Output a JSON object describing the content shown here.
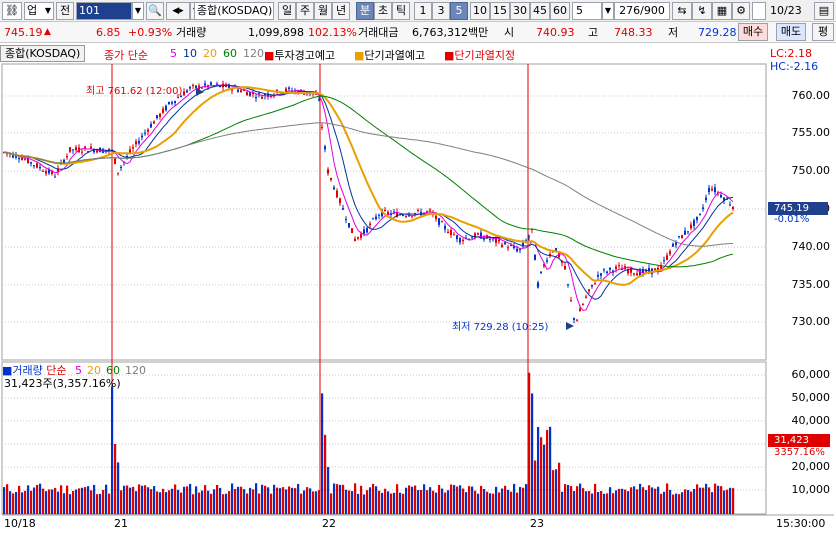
{
  "toolbar": {
    "market": "업",
    "code_label": "전",
    "code_value": "101",
    "index_name": "종합(KOSDAQ)",
    "periods": [
      "일",
      "주",
      "월",
      "년",
      "분",
      "초",
      "틱"
    ],
    "active_period": "분",
    "minutes": [
      "1",
      "3",
      "5",
      "10",
      "15",
      "30",
      "45",
      "60"
    ],
    "active_minute": "5",
    "interval_value": "5",
    "count_display": "276/900",
    "date": "10/23"
  },
  "quote": {
    "price": "745.19",
    "change": "6.85",
    "change_pct": "+0.93%",
    "volume_label": "거래량",
    "volume": "1,099,898",
    "volume_ratio": "102.13%",
    "amount_label": "거래대금",
    "amount": "6,763,312백만",
    "open_label": "시",
    "open": "740.93",
    "high_label": "고",
    "high": "748.33",
    "low_label": "저",
    "low": "729.28",
    "sell_btn": "매수",
    "buy_btn": "매도",
    "eval_btn": "평"
  },
  "tabs": {
    "index_tab": "종합(KOSDAQ)",
    "ma_label": "종가 단순",
    "ma_periods": [
      "5",
      "10",
      "20",
      "60",
      "120"
    ],
    "warn1": "투자경고예고",
    "warn2": "단기과열예고",
    "warn3": "단기과열지정",
    "lc": "LC:2.18",
    "hc": "HC:-2.16"
  },
  "price_chart": {
    "high_note": "최고 761.62 (12:00)",
    "low_note": "최저 729.28 (10:25)",
    "current": "745.19",
    "current_pct": "-0.01%",
    "yticks": [
      "760.00",
      "755.00",
      "750.00",
      "745.00",
      "740.00",
      "735.00",
      "730.00"
    ]
  },
  "volume_chart": {
    "legend_label": "거래량",
    "legend_ma": "단순",
    "legend_periods": [
      "5",
      "20",
      "60",
      "120"
    ],
    "current_info": "31,423주(3,357.16%)",
    "current": "31,423",
    "current_pct": "3357.16%",
    "yticks": [
      "60,000",
      "50,000",
      "40,000",
      "30,000",
      "20,000",
      "10,000"
    ]
  },
  "xaxis": {
    "dates": [
      "10/18",
      "21",
      "22",
      "23"
    ],
    "time": "15:30:00"
  },
  "colors": {
    "up": "#e00000",
    "down": "#0033cc",
    "ma5": "#e000e0",
    "ma10": "#003399",
    "ma20": "#e8a000",
    "ma60": "#008000",
    "ma120": "#808080"
  }
}
